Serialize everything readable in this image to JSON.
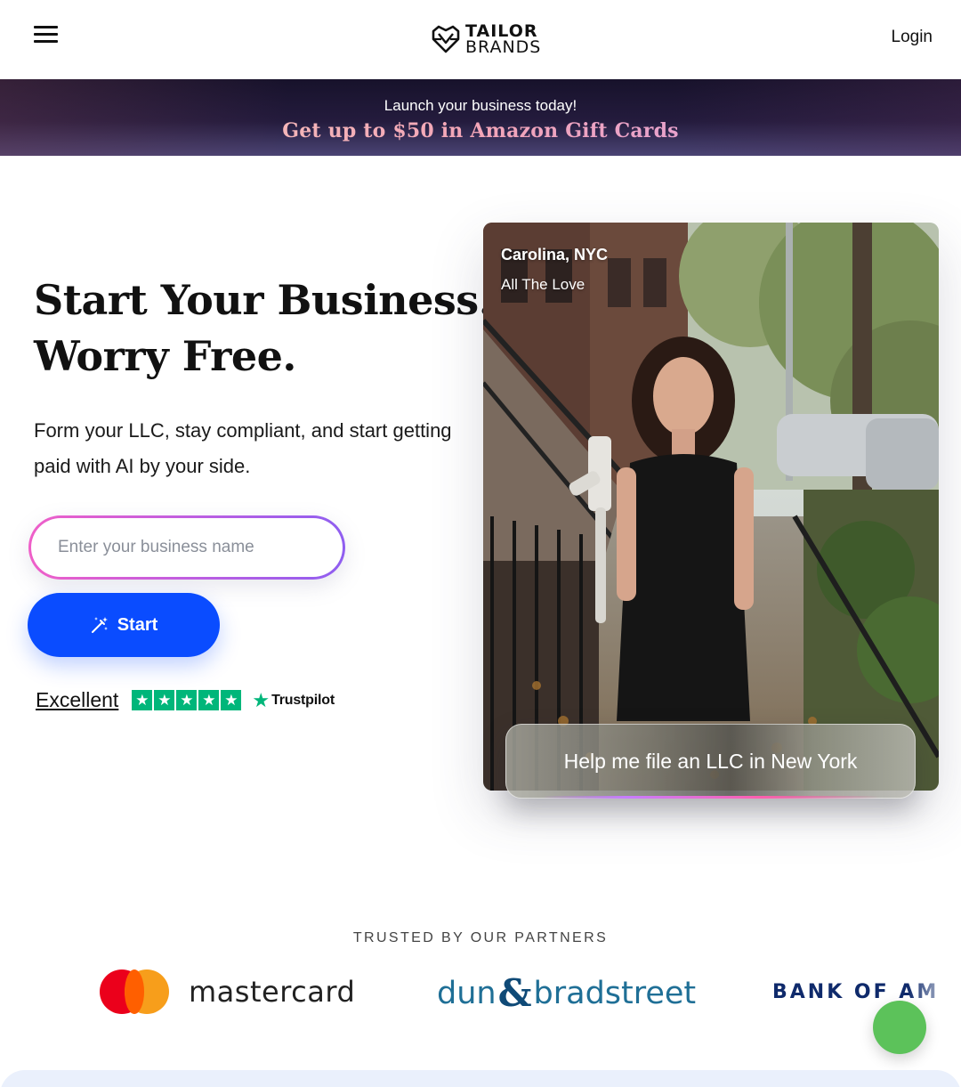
{
  "header": {
    "logo_line1": "TAILOR",
    "logo_line2": "BRANDS",
    "login_label": "Login",
    "menu_icon": "hamburger-menu-icon"
  },
  "promo": {
    "line1": "Launch your business today!",
    "line2": "Get up to $50 in Amazon Gift Cards"
  },
  "hero": {
    "title_line1": "Start Your Business.",
    "title_line2": "Worry Free.",
    "subtitle": "Form your LLC, stay compliant, and start getting paid with AI by your side.",
    "input_placeholder": "Enter your business name",
    "start_label": "Start",
    "start_icon": "magic-wand-icon",
    "rating_label": "Excellent",
    "stars": 5,
    "trustpilot_label": "Trustpilot"
  },
  "photo": {
    "person_location": "Carolina, NYC",
    "business_name": "All The Love",
    "prompt": "Help me file an LLC in New York"
  },
  "partners": {
    "heading": "TRUSTED BY OUR PARTNERS",
    "logos": [
      "mastercard",
      "dun",
      "&",
      "bradstreet",
      "BANK OF AM"
    ]
  },
  "colors": {
    "primary_button": "#0a4cff",
    "trustpilot_green": "#00b67a",
    "chat_bubble": "#5cc25a",
    "promo_bg": "#1c1533"
  }
}
